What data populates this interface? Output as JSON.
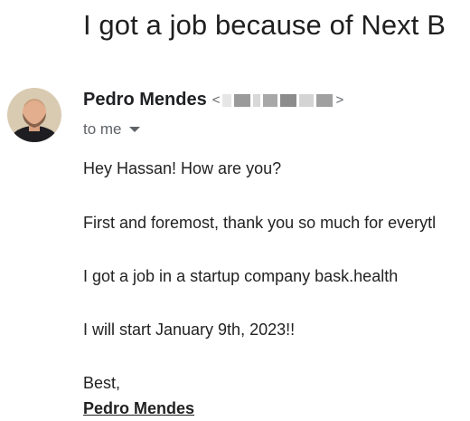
{
  "email": {
    "subject": "I got a job because of Next B",
    "sender": {
      "name": "Pedro Mendes",
      "email_open": "<",
      "email_close": ">"
    },
    "recipient_label": "to me",
    "body": {
      "greeting": "Hey Hassan! How are you?",
      "line1": "First and foremost, thank you so much for everytl",
      "line2": "I got a job in a startup company bask.health",
      "line3": "I will start January 9th, 2023!!",
      "closing": "Best,",
      "signature": "Pedro Mendes"
    }
  },
  "icons": {
    "avatar": "person-avatar",
    "recipient_dropdown": "chevron-down-icon"
  }
}
